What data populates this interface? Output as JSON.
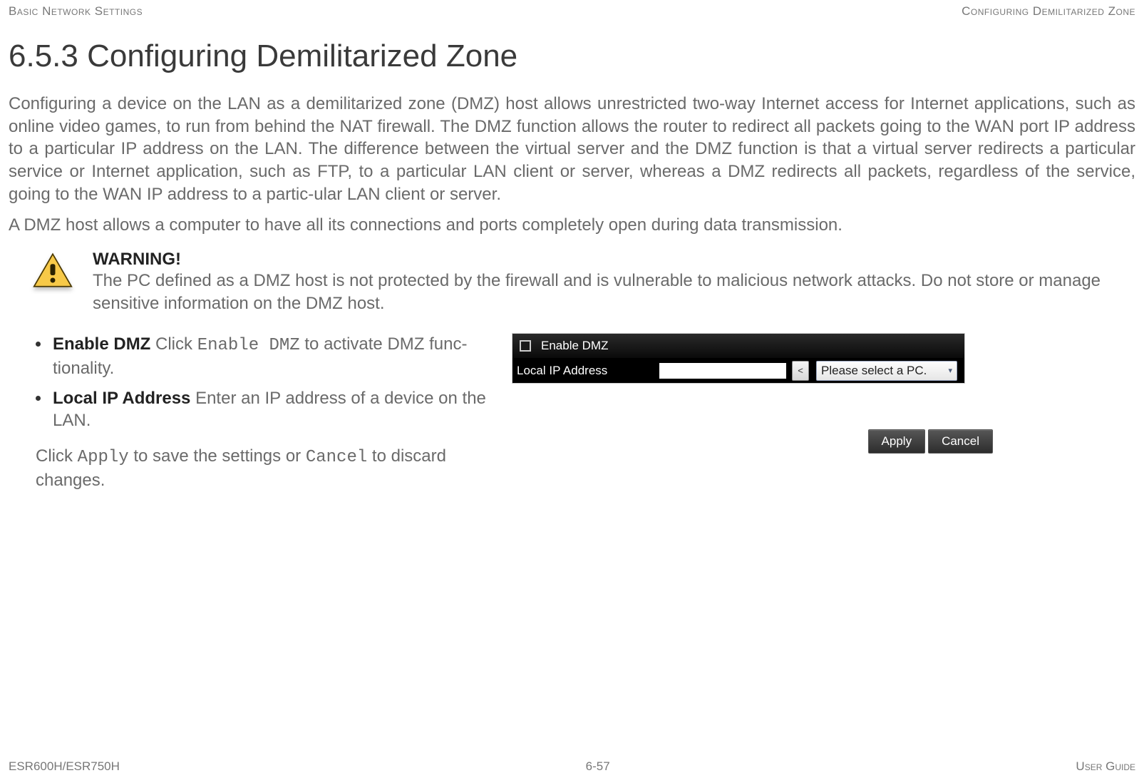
{
  "header": {
    "left": "Basic Network Settings",
    "right": "Configuring Demilitarized Zone"
  },
  "title": "6.5.3 Configuring Demilitarized Zone",
  "para1": "Configuring a device on the LAN as a demilitarized zone (DMZ) host allows unrestricted two-way Internet access for Internet applications, such as online video games, to run from behind the NAT firewall. The DMZ function allows the router to redirect all packets going to the WAN port IP address to a particular IP address on the LAN. The difference between the virtual server and the DMZ function is that a virtual server redirects a particular service or Internet application, such as FTP, to a particular LAN client or server, whereas a DMZ redirects all packets, regardless of the service, going to the WAN IP address to a partic-ular LAN client or server.",
  "para2": "A DMZ host allows a computer to have all its connections and ports completely open during data transmission.",
  "warning": {
    "heading": "WARNING!",
    "body": "The PC defined as a DMZ host is not protected by the firewall and is vulnerable to malicious network attacks. Do not store or manage sensitive information on the DMZ host."
  },
  "defs": {
    "enable_dmz": {
      "term": "Enable DMZ",
      "desc_pre": "  Click ",
      "code": "Enable DMZ",
      "desc_post": " to activate DMZ func-tionality."
    },
    "local_ip": {
      "term": "Local IP Address",
      "desc": "  Enter an IP address of a device on the LAN."
    }
  },
  "action": {
    "pre": "Click ",
    "code1": "Apply",
    "mid": " to save the settings or ",
    "code2": "Cancel",
    "post": " to discard changes."
  },
  "widget": {
    "enable_label": "Enable DMZ",
    "ip_label": "Local IP Address",
    "ip_btn": "<",
    "select_label": "Please select a PC."
  },
  "buttons": {
    "apply": "Apply",
    "cancel": "Cancel"
  },
  "footer": {
    "left": "ESR600H/ESR750H",
    "center": "6-57",
    "right": "User Guide"
  }
}
